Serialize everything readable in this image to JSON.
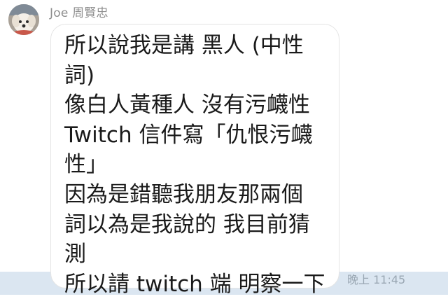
{
  "chat": {
    "sender_name": "Joe 周賢忠",
    "avatar_icon": "dog-photo-avatar",
    "message_lines": [
      "所以說我是講 黑人 (中性",
      "詞)",
      "像白人黃種人 沒有污衊性",
      "Twitch 信件寫「仇恨污衊",
      "性」",
      "因為是錯聽我朋友那兩個",
      "詞以為是我說的 我目前猜",
      "測",
      "所以請 twitch 端 明察一下"
    ],
    "timestamp": "晚上 11:45"
  },
  "colors": {
    "background": "#ffffff",
    "bottom_band": "#dbe6f1",
    "bubble": "#ffffff",
    "text": "#1a1a1a",
    "meta_text": "#8d8d8d"
  }
}
